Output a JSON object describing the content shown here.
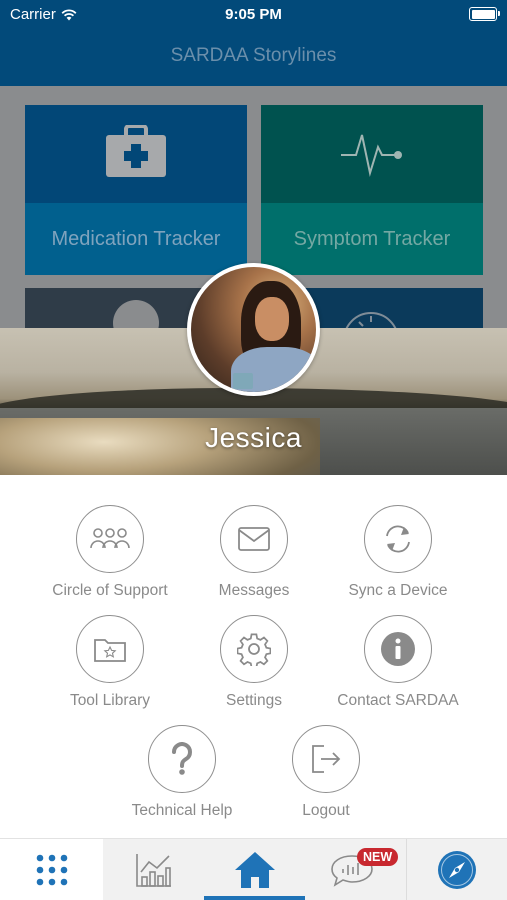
{
  "status_bar": {
    "carrier": "Carrier",
    "time": "9:05 PM"
  },
  "nav": {
    "title": "SARDAA Storylines"
  },
  "dashboard": {
    "tiles": [
      {
        "label": "Medication Tracker",
        "icon": "medical-kit-icon"
      },
      {
        "label": "Symptom Tracker",
        "icon": "heartbeat-icon"
      }
    ]
  },
  "profile": {
    "name": "Jessica"
  },
  "menu": {
    "items": [
      {
        "label": "Circle of Support",
        "icon": "people-group-icon"
      },
      {
        "label": "Messages",
        "icon": "envelope-icon"
      },
      {
        "label": "Sync a Device",
        "icon": "sync-icon"
      },
      {
        "label": "Tool Library",
        "icon": "folder-star-icon"
      },
      {
        "label": "Settings",
        "icon": "gear-icon"
      },
      {
        "label": "Contact SARDAA",
        "icon": "info-icon"
      },
      {
        "label": "Technical Help",
        "icon": "question-mark-icon"
      },
      {
        "label": "Logout",
        "icon": "logout-icon"
      }
    ]
  },
  "tabbar": {
    "new_badge": "NEW",
    "active_tab": "home"
  },
  "colors": {
    "header": "#024a7a",
    "accent": "#1f73b7",
    "badge": "#c8282f"
  }
}
